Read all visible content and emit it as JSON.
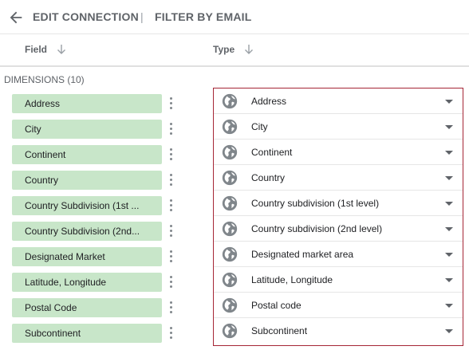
{
  "header": {
    "title": "EDIT CONNECTION",
    "separator": "|",
    "subtitle": "FILTER BY EMAIL",
    "back_icon": "arrow-left-icon"
  },
  "columns": {
    "field": "Field",
    "type": "Type",
    "sort_icon": "arrow-down-icon"
  },
  "section": {
    "label": "DIMENSIONS (10)"
  },
  "colors": {
    "chip_background": "#c8e6c9",
    "type_box_border": "#a52535",
    "icon_gray": "#80868b"
  },
  "rows": [
    {
      "field": "Address",
      "type": "Address",
      "type_icon": "globe-icon"
    },
    {
      "field": "City",
      "type": "City",
      "type_icon": "globe-icon"
    },
    {
      "field": "Continent",
      "type": "Continent",
      "type_icon": "globe-icon"
    },
    {
      "field": "Country",
      "type": "Country",
      "type_icon": "globe-icon"
    },
    {
      "field": "Country Subdivision (1st ...",
      "type": "Country subdivision (1st level)",
      "type_icon": "globe-icon"
    },
    {
      "field": "Country Subdivision (2nd...",
      "type": "Country subdivision (2nd level)",
      "type_icon": "globe-icon"
    },
    {
      "field": "Designated Market",
      "type": "Designated market area",
      "type_icon": "globe-icon"
    },
    {
      "field": "Latitude, Longitude",
      "type": "Latitude, Longitude",
      "type_icon": "globe-icon"
    },
    {
      "field": "Postal Code",
      "type": "Postal code",
      "type_icon": "globe-icon"
    },
    {
      "field": "Subcontinent",
      "type": "Subcontinent",
      "type_icon": "globe-icon"
    }
  ]
}
